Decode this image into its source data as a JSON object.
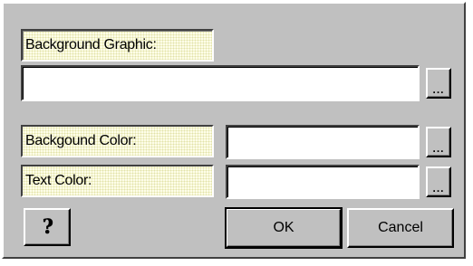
{
  "dialog": {
    "background_graphic": {
      "label": "Background Graphic:",
      "value": "",
      "browse_label": "..."
    },
    "background_color": {
      "label": "Backgound Color:",
      "value": "",
      "browse_label": "..."
    },
    "text_color": {
      "label": "Text Color:",
      "value": "",
      "browse_label": "..."
    },
    "help_icon": "?",
    "ok_label": "OK",
    "cancel_label": "Cancel"
  },
  "colors": {
    "dialog_face": "#c0c0c0",
    "label_fill": "#fdfde8",
    "field_fill": "#ffffff"
  },
  "icons": {
    "help": "help-question-icon"
  }
}
